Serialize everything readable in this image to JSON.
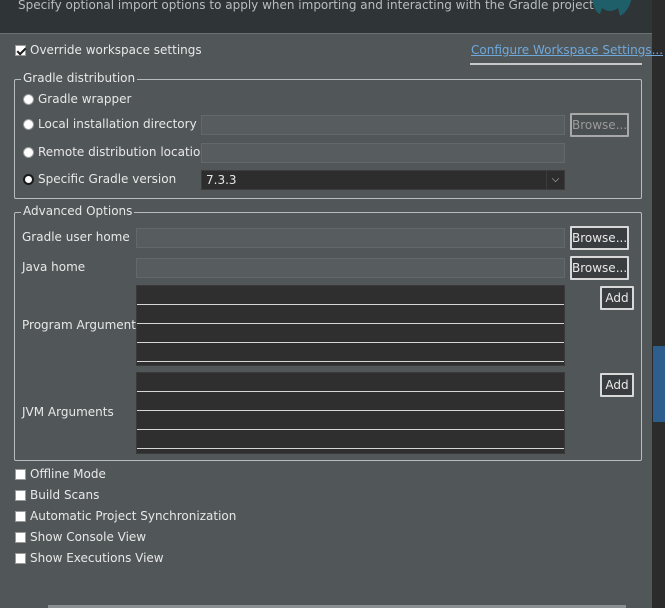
{
  "header": {
    "description": "Specify optional import options to apply when importing and interacting with the Gradle project."
  },
  "override": {
    "label": "Override workspace settings",
    "checked": true,
    "configure_link": "Configure Workspace Settings..."
  },
  "distribution": {
    "title": "Gradle distribution",
    "options": [
      {
        "label": "Gradle wrapper",
        "selected": false
      },
      {
        "label": "Local installation directory",
        "selected": false
      },
      {
        "label": "Remote distribution location",
        "selected": false
      },
      {
        "label": "Specific Gradle version",
        "selected": true
      }
    ],
    "local_browse": "Browse...",
    "version_value": "7.3.3"
  },
  "advanced": {
    "title": "Advanced Options",
    "gradle_user_home_label": "Gradle user home",
    "java_home_label": "Java home",
    "browse_label": "Browse...",
    "program_arguments_label": "Program Arguments",
    "jvm_arguments_label": "JVM Arguments",
    "add_label": "Add"
  },
  "options": [
    {
      "label": "Offline Mode",
      "checked": false
    },
    {
      "label": "Build Scans",
      "checked": false
    },
    {
      "label": "Automatic Project Synchronization",
      "checked": false
    },
    {
      "label": "Show Console View",
      "checked": false
    },
    {
      "label": "Show Executions View",
      "checked": false
    }
  ],
  "colors": {
    "panel": "#515658",
    "link": "#6fa9dc",
    "scroll_thumb": "#2e5e8e"
  }
}
